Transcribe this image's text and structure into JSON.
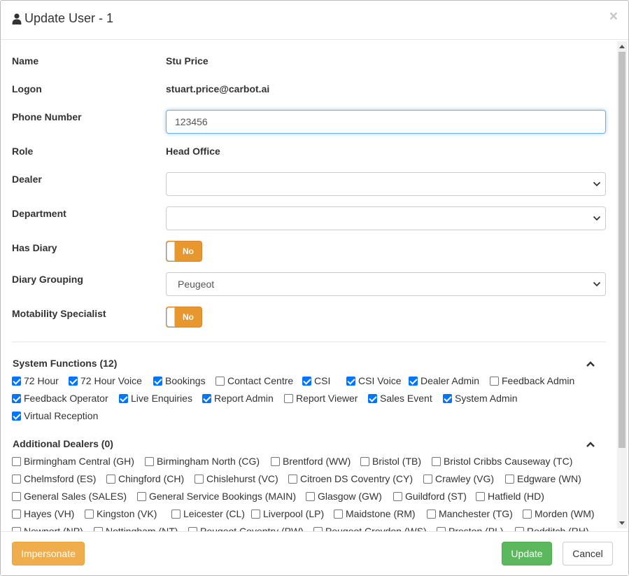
{
  "header": {
    "title": "Update User - 1",
    "close_label": "×",
    "user_icon": "user-icon"
  },
  "form": {
    "name_label": "Name",
    "name_value": "Stu Price",
    "logon_label": "Logon",
    "logon_value": "stuart.price@carbot.ai",
    "phone_label": "Phone Number",
    "phone_value": "123456",
    "role_label": "Role",
    "role_value": "Head Office",
    "dealer_label": "Dealer",
    "dealer_value": "",
    "department_label": "Department",
    "department_value": "",
    "has_diary_label": "Has Diary",
    "has_diary_toggle": "No",
    "diary_grouping_label": "Diary Grouping",
    "diary_grouping_value": "Peugeot",
    "motability_label": "Motability Specialist",
    "motability_toggle": "No"
  },
  "system_functions": {
    "title": "System Functions (12)",
    "rows": [
      [
        {
          "label": "72 Hour",
          "checked": true
        },
        {
          "label": "72 Hour Voice",
          "checked": true
        },
        {
          "label": "Bookings",
          "checked": true
        },
        {
          "label": "Contact Centre",
          "checked": false
        },
        {
          "label": "CSI",
          "checked": true
        },
        {
          "label": "CSI Voice",
          "checked": true
        },
        {
          "label": "Dealer Admin",
          "checked": true
        },
        {
          "label": "Feedback Admin",
          "checked": false
        }
      ],
      [
        {
          "label": "Feedback Operator",
          "checked": true
        },
        {
          "label": "Live Enquiries",
          "checked": true
        },
        {
          "label": "Report Admin",
          "checked": true
        },
        {
          "label": "Report Viewer",
          "checked": false
        },
        {
          "label": "Sales Event",
          "checked": true
        },
        {
          "label": "System Admin",
          "checked": true
        }
      ],
      [
        {
          "label": "Virtual Reception",
          "checked": true
        }
      ]
    ]
  },
  "additional_dealers": {
    "title": "Additional Dealers (0)",
    "rows": [
      [
        {
          "label": "Birmingham Central (GH)",
          "checked": false
        },
        {
          "label": "Birmingham North (CG)",
          "checked": false
        },
        {
          "label": "Brentford (WW)",
          "checked": false
        },
        {
          "label": "Bristol (TB)",
          "checked": false
        },
        {
          "label": "Bristol Cribbs Causeway (TC)",
          "checked": false
        }
      ],
      [
        {
          "label": "Chelmsford (ES)",
          "checked": false
        },
        {
          "label": "Chingford (CH)",
          "checked": false
        },
        {
          "label": "Chislehurst (VC)",
          "checked": false
        },
        {
          "label": "Citroen DS Coventry (CY)",
          "checked": false
        },
        {
          "label": "Crawley (VG)",
          "checked": false
        },
        {
          "label": "Edgware (WN)",
          "checked": false
        }
      ],
      [
        {
          "label": "General Sales (SALES)",
          "checked": false
        },
        {
          "label": "General Service Bookings (MAIN)",
          "checked": false
        },
        {
          "label": "Glasgow (GW)",
          "checked": false
        },
        {
          "label": "Guildford (ST)",
          "checked": false
        },
        {
          "label": "Hatfield (HD)",
          "checked": false
        }
      ],
      [
        {
          "label": "Hayes (VH)",
          "checked": false
        },
        {
          "label": "Kingston (VK)",
          "checked": false
        },
        {
          "label": "Leicester (CL)",
          "checked": false
        },
        {
          "label": "Liverpool (LP)",
          "checked": false
        },
        {
          "label": "Maidstone (RM)",
          "checked": false
        },
        {
          "label": "Manchester (TG)",
          "checked": false
        },
        {
          "label": "Morden (WM)",
          "checked": false
        }
      ],
      [
        {
          "label": "Newport (NP)",
          "checked": false
        },
        {
          "label": "Nottingham (NT)",
          "checked": false
        },
        {
          "label": "Peugeot Coventry (PW)",
          "checked": false
        },
        {
          "label": "Peugeot Croydon (WS)",
          "checked": false
        },
        {
          "label": "Preston (PL)",
          "checked": false
        },
        {
          "label": "Redditch (RH)",
          "checked": false
        }
      ]
    ]
  },
  "footer": {
    "impersonate_label": "Impersonate",
    "update_label": "Update",
    "cancel_label": "Cancel"
  }
}
